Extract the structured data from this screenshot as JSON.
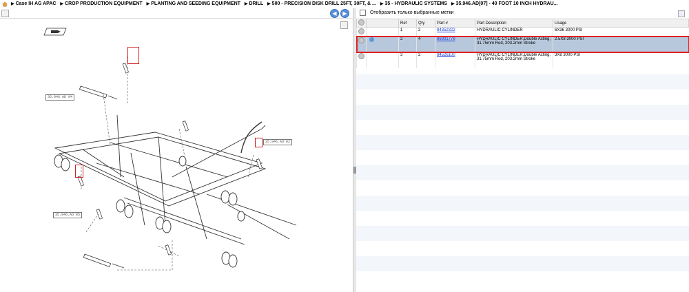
{
  "breadcrumb": [
    "Case IH AG APAC",
    "CROP PRODUCTION EQUIPMENT",
    "PLANTING AND SEEDING EQUIPMENT",
    "DRILL",
    "500 - PRECISION DISK DRILL 25FT, 30FT, & ...",
    "35 - HYDRAULIC SYSTEMS",
    "35.946.AD[07] - 40 FOOT 10 INCH HYDRAU..."
  ],
  "filter": {
    "label": "Отобразить только выбранные метки"
  },
  "table": {
    "headers": [
      "",
      "Ref",
      "Qty",
      "Part #",
      "Part Description",
      "Usage"
    ],
    "rows": [
      {
        "ref": "1",
        "qty": "2",
        "part": "84352322",
        "desc1": "HYDRAULIC CYLINDER",
        "desc2": "",
        "usage": "6X36 3000 PSI"
      },
      {
        "ref": "2",
        "qty": "4",
        "part": "86991779",
        "desc1": "HYDRAULIC CYLINDER,Double Acting,",
        "desc2": "31.75mm Rod, 203.2mm Stroke",
        "usage": "2.5X8 3000 PSI"
      },
      {
        "ref": "3",
        "qty": "2",
        "part": "84526100",
        "desc1": "HYDRAULIC CYLINDER,Double Acting,",
        "desc2": "31.75mm Rod, 203.2mm Stroke",
        "usage": "3X8 3000 PSI"
      }
    ]
  },
  "callouts": [
    "35.946.AD 04",
    "35.946.AD 02",
    "35.946.AD 05"
  ],
  "colors": {
    "selected_row": "#b7c8dc",
    "highlight": "#e02020",
    "link": "#1a3fd8"
  }
}
